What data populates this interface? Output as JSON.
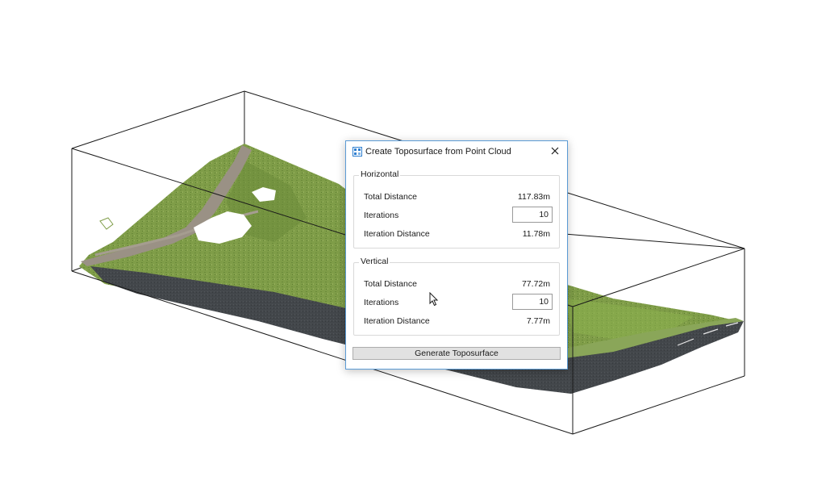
{
  "dialog": {
    "title": "Create Toposurface from Point Cloud",
    "icon": "toposurface-icon",
    "close_icon": "close-icon",
    "horizontal": {
      "legend": "Horizontal",
      "total_distance_label": "Total Distance",
      "total_distance_value": "117.83m",
      "iterations_label": "Iterations",
      "iterations_value": "10",
      "iteration_distance_label": "Iteration Distance",
      "iteration_distance_value": "11.78m"
    },
    "vertical": {
      "legend": "Vertical",
      "total_distance_label": "Total Distance",
      "total_distance_value": "77.72m",
      "iterations_label": "Iterations",
      "iterations_value": "10",
      "iteration_distance_label": "Iteration Distance",
      "iteration_distance_value": "7.77m"
    },
    "generate_button": "Generate Toposurface"
  },
  "viewport": {
    "content": "point-cloud",
    "colors": {
      "grass": "#7a9a45",
      "grass_dark": "#5f7f33",
      "road": "#3e4246",
      "path": "#9a9185",
      "bounding_box": "#1a1a1a",
      "dialog_border": "#5b9bd5"
    }
  }
}
